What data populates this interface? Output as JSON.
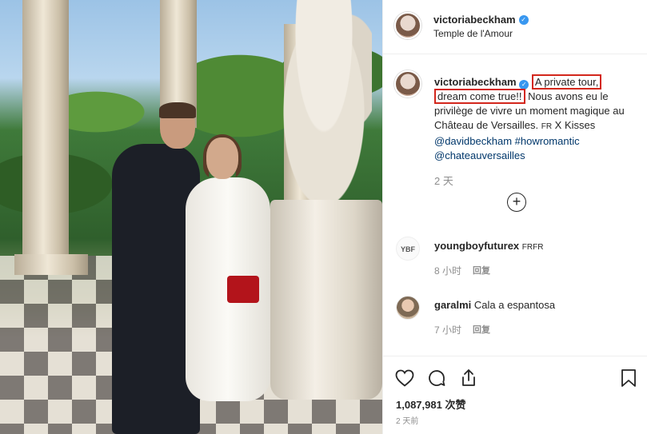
{
  "post": {
    "username": "victoriabeckham",
    "location": "Temple de l'Amour",
    "caption": {
      "username": "victoriabeckham",
      "highlight1": "A private tour,",
      "highlight2": "dream come true!!",
      "text1": " Nous avons eu le privilège de vivre un moment magique au Château de Versailles.",
      "lang_tag": "FR",
      "text2": " X Kisses ",
      "mention1": "@davidbeckham",
      "hashtag": "#howromantic",
      "mention2": "@chateauversailles"
    },
    "caption_time": "2 天"
  },
  "comments": [
    {
      "avatar_text": "YBF",
      "username": "youngboyfuturex",
      "text": "FRFR",
      "time": "8 小时",
      "reply": "回复"
    },
    {
      "avatar_text": "",
      "username": "garalmi",
      "text": "Cala a espantosa",
      "time": "7 小时",
      "reply": "回复"
    }
  ],
  "footer": {
    "likes": "1,087,981 次赞",
    "date": "2 天前"
  },
  "icons": {
    "verified": "verified-badge-icon",
    "more": "plus-circle-icon",
    "like": "heart-icon",
    "comment": "speech-bubble-icon",
    "share": "share-icon",
    "save": "bookmark-icon"
  },
  "colors": {
    "verified_blue": "#3897f0",
    "link": "#00376b",
    "highlight_box": "#d3271c",
    "muted": "#8e8e8e"
  }
}
